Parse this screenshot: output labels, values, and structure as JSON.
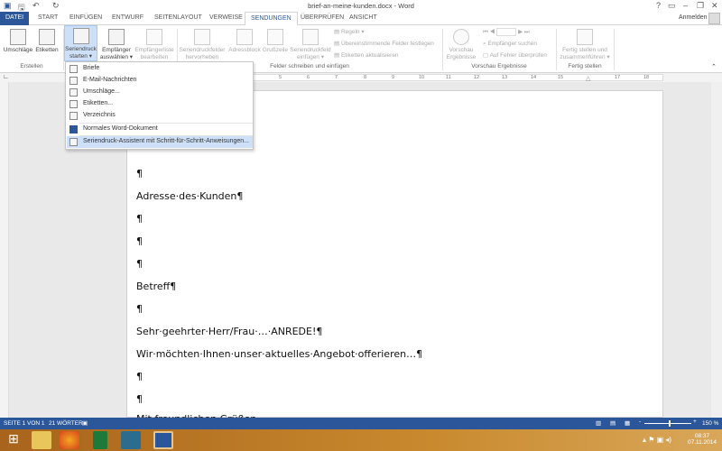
{
  "titlebar": {
    "title": "brief-an-meine-kunden.docx - Word",
    "help": "?",
    "signin": "Anmelden"
  },
  "tabs": [
    "DATEI",
    "START",
    "EINFÜGEN",
    "ENTWURF",
    "SEITENLAYOUT",
    "VERWEISE",
    "SENDUNGEN",
    "ÜBERPRÜFEN",
    "ANSICHT"
  ],
  "ribbon": {
    "umschlaege": "Umschläge",
    "etiketten": "Etiketten",
    "seriendruck1": "Seriendruck",
    "seriendruck2": "starten ▾",
    "empf1": "Empfänger",
    "empf2": "auswählen ▾",
    "liste1": "Empfängerliste",
    "liste2": "bearbeiten",
    "felder1": "Seriendruckfelder",
    "felder2": "hervorheben",
    "adress": "Adressblock",
    "gruss": "Grußzeile",
    "feld1": "Seriendruckfeld",
    "feld2": "einfügen ▾",
    "regeln": "Regeln ▾",
    "uebereinst": "Übereinstimmende Felder festlegen",
    "aktual": "Etiketten aktualisieren",
    "vorschau1": "Vorschau",
    "vorschau2": "Ergebnisse",
    "suchen": "Empfänger suchen",
    "fehler": "Auf Fehler überprüfen",
    "fertig1": "Fertig stellen und",
    "fertig2": "zusammenführen ▾",
    "groups": {
      "erstellen": "Erstellen",
      "felder": "Felder schreiben und einfügen",
      "vorschau": "Vorschau Ergebnisse",
      "fertig": "Fertig stellen"
    }
  },
  "menu": [
    "Briefe",
    "E-Mail-Nachrichten",
    "Umschläge...",
    "Etiketten...",
    "Verzeichnis",
    "Normales Word-Dokument",
    "Seriendruck-Assistent mit Schritt-für-Schritt-Anweisungen..."
  ],
  "ruler": [
    "5",
    "6",
    "7",
    "8",
    "9",
    "10",
    "11",
    "12",
    "13",
    "14",
    "15",
    "17",
    "18"
  ],
  "document": [
    "¶",
    "Adresse·des·Kunden¶",
    "¶",
    "¶",
    "¶",
    "Betreff¶",
    "¶",
    "Sehr·geehrter·Herr/Frau·…·ANREDE!¶",
    "Wir·möchten·Ihnen·unser·aktuelles·Angebot·offerieren…¶",
    "¶",
    "¶",
    "Mit·freundlichen·Grüßen"
  ],
  "status": {
    "page": "SEITE 1 VON 1",
    "words": "21 WÖRTER",
    "zoom": "150 %"
  },
  "clock": {
    "time": "08:37",
    "date": "07.11.2014"
  }
}
